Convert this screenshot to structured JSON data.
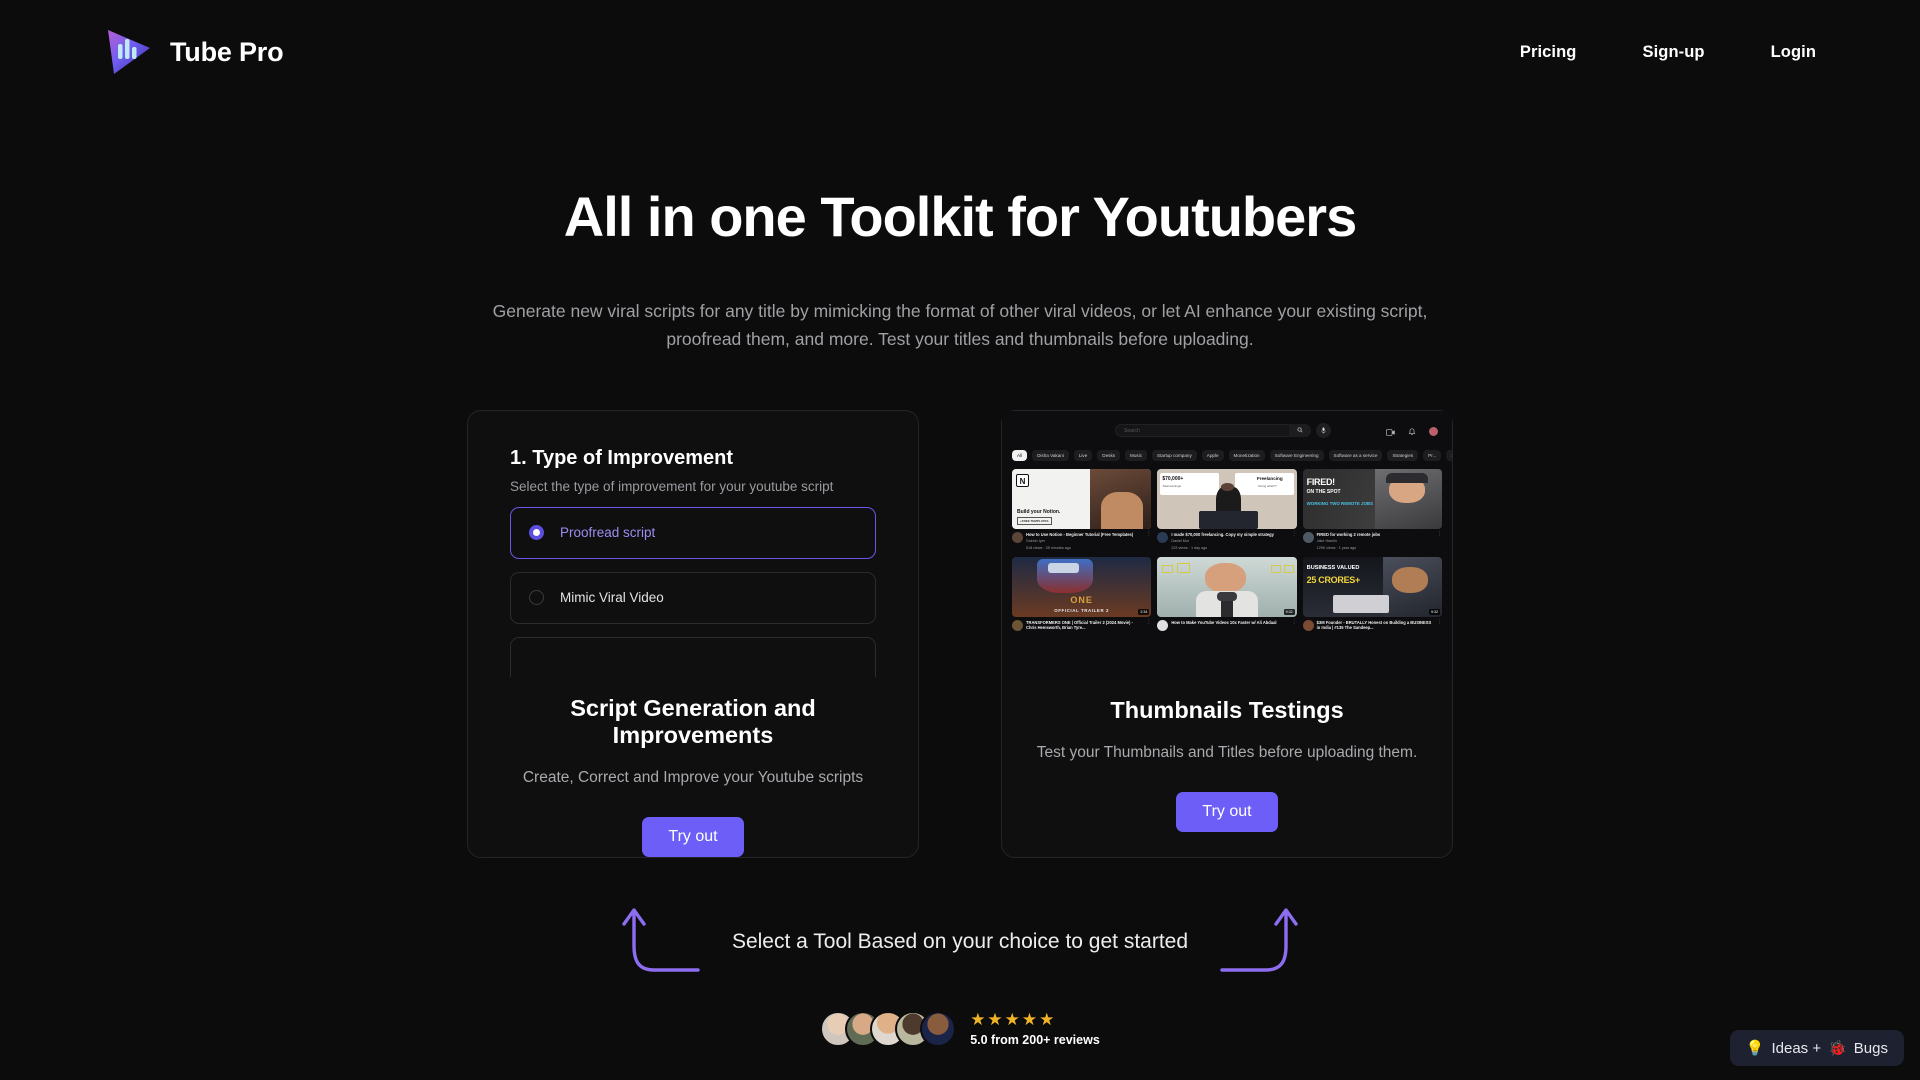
{
  "header": {
    "brand_name": "Tube Pro",
    "logo_icon": "tube-pro-logo-icon",
    "nav": [
      {
        "label": "Pricing"
      },
      {
        "label": "Sign-up"
      },
      {
        "label": "Login"
      }
    ]
  },
  "hero": {
    "title": "All in one Toolkit for Youtubers",
    "subtitle": "Generate new viral scripts for any title by mimicking the format of other viral videos, or let AI enhance your existing script, proofread them, and more. Test your titles and thumbnails before uploading."
  },
  "cards": {
    "script": {
      "form": {
        "heading": "1. Type of Improvement",
        "subheading": "Select the type of improvement for your youtube script",
        "options": [
          {
            "label": "Proofread script",
            "selected": true
          },
          {
            "label": "Mimic Viral Video",
            "selected": false
          }
        ]
      },
      "title": "Script Generation and Improvements",
      "description": "Create, Correct and Improve your Youtube scripts",
      "cta": "Try out"
    },
    "thumbnails": {
      "title": "Thumbnails Testings",
      "description": "Test your Thumbnails and Titles before uploading them.",
      "cta": "Try out",
      "preview": {
        "search_placeholder": "Search",
        "search_icon": "magnifier-icon",
        "mic_icon": "microphone-icon",
        "create_icon": "create-video-icon",
        "bell_icon": "notifications-bell-icon",
        "avatar_icon": "account-avatar-icon",
        "chips": [
          "All",
          "Disha Vakani",
          "Live",
          "Desks",
          "Music",
          "Startup company",
          "Apple",
          "Monetization",
          "Software Engineering",
          "Software as a service",
          "Strategies",
          "Pr..."
        ],
        "videos": [
          {
            "title": "How to Use Notion - Beginner Tutorial (Free Templates)",
            "channel": "Gokhin Iyer",
            "stats": "518 views · 35 minutes ago",
            "duration": "",
            "thumb_text_main": "Build your Notion.",
            "thumb_text_sub": "+FREE TEMPLATES"
          },
          {
            "title": "I made $70,000 freelancing. Copy my simple strategy",
            "channel": "Daniel Mor",
            "stats": "223 views · 1 day ago",
            "duration": "",
            "thumb_text_main": "$70,000+",
            "thumb_text_sub": "Total earnings",
            "thumb_text_main2": "Freelancing",
            "thumb_text_sub2": "Doing what??"
          },
          {
            "title": "FIRED for working 2 remote jobs",
            "channel": "Jake Hamlin",
            "stats": "129K views · 1 year ago",
            "duration": "",
            "thumb_text_main": "FIRED!",
            "thumb_text_sub": "ON THE SPOT",
            "thumb_text_main2": "WORKING TWO REMOTE JOBS"
          },
          {
            "title": "TRANSFORMERS ONE | Official Trailer 2 (2024 Movie) - Chris Hemsworth, Brian Tyre...",
            "channel": "",
            "stats": "",
            "duration": "2:34",
            "thumb_text_main": "ONE",
            "thumb_text_sub": "OFFICIAL TRAILER 2"
          },
          {
            "title": "How to Make YouTube Videos 10x Faster w/ Ali Abdaal",
            "channel": "",
            "stats": "",
            "duration": "9:32",
            "thumb_text_main": "",
            "thumb_text_sub": ""
          },
          {
            "title": "$3M Founder - BRUTALLY Honest on Building a BUSINESS in India | #135 The Sandeep...",
            "channel": "",
            "stats": "",
            "duration": "9:32",
            "thumb_text_main": "BUSINESS VALUED",
            "thumb_text_sub": "25 CRORES+"
          }
        ]
      }
    }
  },
  "guidance": {
    "text": "Select a Tool Based on your choice to get started",
    "left_arrow_icon": "curved-arrow-up-left-icon",
    "right_arrow_icon": "curved-arrow-up-right-icon"
  },
  "reviews": {
    "stars": "★★★★★",
    "caption": "5.0 from 200+ reviews",
    "avatar_count": 5
  },
  "widget": {
    "idea_icon": "💡",
    "label_ideas": "Ideas +",
    "bug_icon": "🐞",
    "label_bugs": "Bugs"
  },
  "colors": {
    "accent": "#6c5ef6",
    "accent_soft": "#9d8cf0",
    "background": "#0c0c0c",
    "card": "#0f0f0f",
    "star": "#f0b429"
  }
}
